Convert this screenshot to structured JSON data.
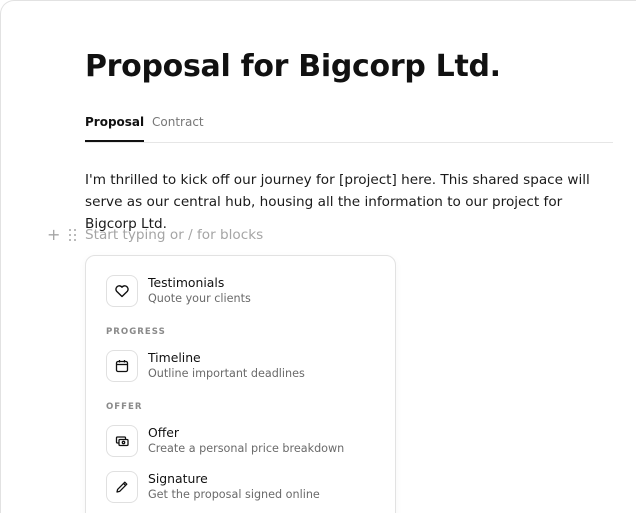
{
  "document": {
    "title": "Proposal for Bigcorp Ltd.",
    "tabs": [
      {
        "label": "Proposal",
        "active": true
      },
      {
        "label": "Contract",
        "active": false
      }
    ],
    "intro": "I'm thrilled to kick off our journey for [project] here. This shared space will serve as our central hub, housing all the information to our project for Bigcorp Ltd.",
    "block_placeholder": "Start typing or / for blocks",
    "add_symbol": "+"
  },
  "block_menu": {
    "items_top": [
      {
        "title": "Testimonials",
        "description": "Quote your clients",
        "icon": "heart-icon"
      }
    ],
    "sections": [
      {
        "label": "PROGRESS",
        "items": [
          {
            "title": "Timeline",
            "description": "Outline important deadlines",
            "icon": "calendar-icon"
          }
        ]
      },
      {
        "label": "OFFER",
        "items": [
          {
            "title": "Offer",
            "description": "Create a personal price breakdown",
            "icon": "price-tag-icon"
          },
          {
            "title": "Signature",
            "description": "Get the proposal signed online",
            "icon": "pen-icon"
          }
        ]
      }
    ]
  },
  "colors": {
    "text": "#111111",
    "muted": "#6a6a6a",
    "placeholder": "#a5a5a5",
    "border": "#e2e2e2"
  }
}
